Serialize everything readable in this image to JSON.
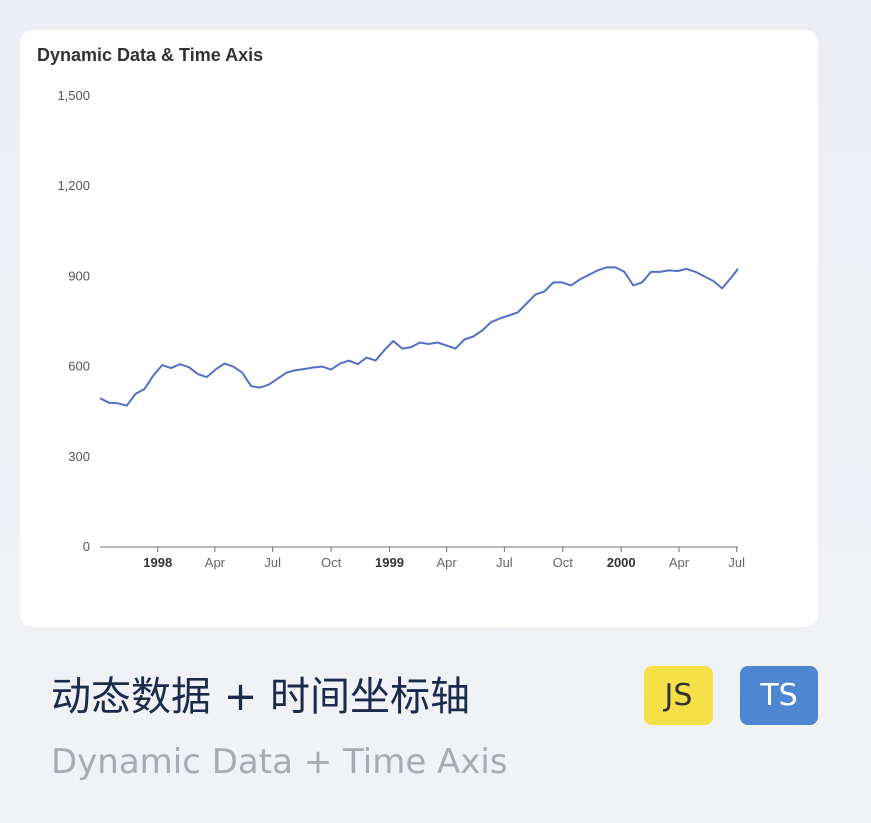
{
  "card": {
    "title_zh": "动态数据 + 时间坐标轴",
    "title_en": "Dynamic Data + Time Axis",
    "badges": [
      {
        "label": "JS",
        "bg": "#f5e048",
        "fg": "#333333"
      },
      {
        "label": "TS",
        "bg": "#4f86d1",
        "fg": "#ffffff"
      }
    ]
  },
  "chart_data": {
    "type": "line",
    "title": "Dynamic Data & Time Axis",
    "xlabel": "",
    "ylabel": "",
    "ylim": [
      0,
      1500
    ],
    "y_ticks": [
      "0",
      "300",
      "600",
      "900",
      "1,200",
      "1,500"
    ],
    "x_ticks": [
      {
        "label": "1998",
        "date": "1998-01-01",
        "major": true
      },
      {
        "label": "Apr",
        "date": "1998-04-01",
        "major": false
      },
      {
        "label": "Jul",
        "date": "1998-07-01",
        "major": false
      },
      {
        "label": "Oct",
        "date": "1998-10-01",
        "major": false
      },
      {
        "label": "1999",
        "date": "1999-01-01",
        "major": true
      },
      {
        "label": "Apr",
        "date": "1999-04-01",
        "major": false
      },
      {
        "label": "Jul",
        "date": "1999-07-01",
        "major": false
      },
      {
        "label": "Oct",
        "date": "1999-10-01",
        "major": false
      },
      {
        "label": "2000",
        "date": "2000-01-01",
        "major": true
      },
      {
        "label": "Apr",
        "date": "2000-04-01",
        "major": false
      },
      {
        "label": "Jul",
        "date": "2000-07-01",
        "major": false
      }
    ],
    "xlim": [
      "1997-10-02",
      "2000-07-03"
    ],
    "grid": false,
    "color": "#5470c6",
    "series": [
      {
        "points": [
          [
            "1997-10-02",
            495
          ],
          [
            "1997-10-16",
            480
          ],
          [
            "1997-10-30",
            478
          ],
          [
            "1997-11-13",
            470
          ],
          [
            "1997-11-27",
            510
          ],
          [
            "1997-12-11",
            525
          ],
          [
            "1997-12-25",
            570
          ],
          [
            "1998-01-08",
            605
          ],
          [
            "1998-01-22",
            595
          ],
          [
            "1998-02-05",
            608
          ],
          [
            "1998-02-19",
            598
          ],
          [
            "1998-03-05",
            575
          ],
          [
            "1998-03-19",
            565
          ],
          [
            "1998-04-02",
            590
          ],
          [
            "1998-04-16",
            610
          ],
          [
            "1998-04-30",
            600
          ],
          [
            "1998-05-14",
            580
          ],
          [
            "1998-05-28",
            535
          ],
          [
            "1998-06-11",
            530
          ],
          [
            "1998-06-25",
            540
          ],
          [
            "1998-07-09",
            560
          ],
          [
            "1998-07-23",
            580
          ],
          [
            "1998-08-06",
            588
          ],
          [
            "1998-08-20",
            592
          ],
          [
            "1998-09-03",
            597
          ],
          [
            "1998-09-17",
            600
          ],
          [
            "1998-10-01",
            590
          ],
          [
            "1998-10-15",
            610
          ],
          [
            "1998-10-29",
            620
          ],
          [
            "1998-11-12",
            608
          ],
          [
            "1998-11-26",
            630
          ],
          [
            "1998-12-10",
            620
          ],
          [
            "1998-12-24",
            655
          ],
          [
            "1999-01-07",
            685
          ],
          [
            "1999-01-21",
            660
          ],
          [
            "1999-02-04",
            665
          ],
          [
            "1999-02-18",
            680
          ],
          [
            "1999-03-04",
            675
          ],
          [
            "1999-03-18",
            680
          ],
          [
            "1999-04-01",
            670
          ],
          [
            "1999-04-15",
            660
          ],
          [
            "1999-04-29",
            690
          ],
          [
            "1999-05-13",
            700
          ],
          [
            "1999-05-27",
            720
          ],
          [
            "1999-06-10",
            748
          ],
          [
            "1999-06-24",
            760
          ],
          [
            "1999-07-08",
            770
          ],
          [
            "1999-07-22",
            780
          ],
          [
            "1999-08-05",
            810
          ],
          [
            "1999-08-19",
            840
          ],
          [
            "1999-09-02",
            850
          ],
          [
            "1999-09-16",
            880
          ],
          [
            "1999-09-30",
            880
          ],
          [
            "1999-10-14",
            870
          ],
          [
            "1999-10-28",
            890
          ],
          [
            "1999-11-11",
            905
          ],
          [
            "1999-11-25",
            920
          ],
          [
            "1999-12-09",
            930
          ],
          [
            "1999-12-23",
            930
          ],
          [
            "2000-01-06",
            915
          ],
          [
            "2000-01-20",
            870
          ],
          [
            "2000-02-03",
            880
          ],
          [
            "2000-02-17",
            915
          ],
          [
            "2000-03-02",
            915
          ],
          [
            "2000-03-16",
            920
          ],
          [
            "2000-03-30",
            918
          ],
          [
            "2000-04-13",
            925
          ],
          [
            "2000-04-27",
            915
          ],
          [
            "2000-05-11",
            900
          ],
          [
            "2000-05-25",
            885
          ],
          [
            "2000-06-08",
            860
          ],
          [
            "2000-06-22",
            895
          ],
          [
            "2000-07-03",
            925
          ]
        ]
      }
    ]
  }
}
